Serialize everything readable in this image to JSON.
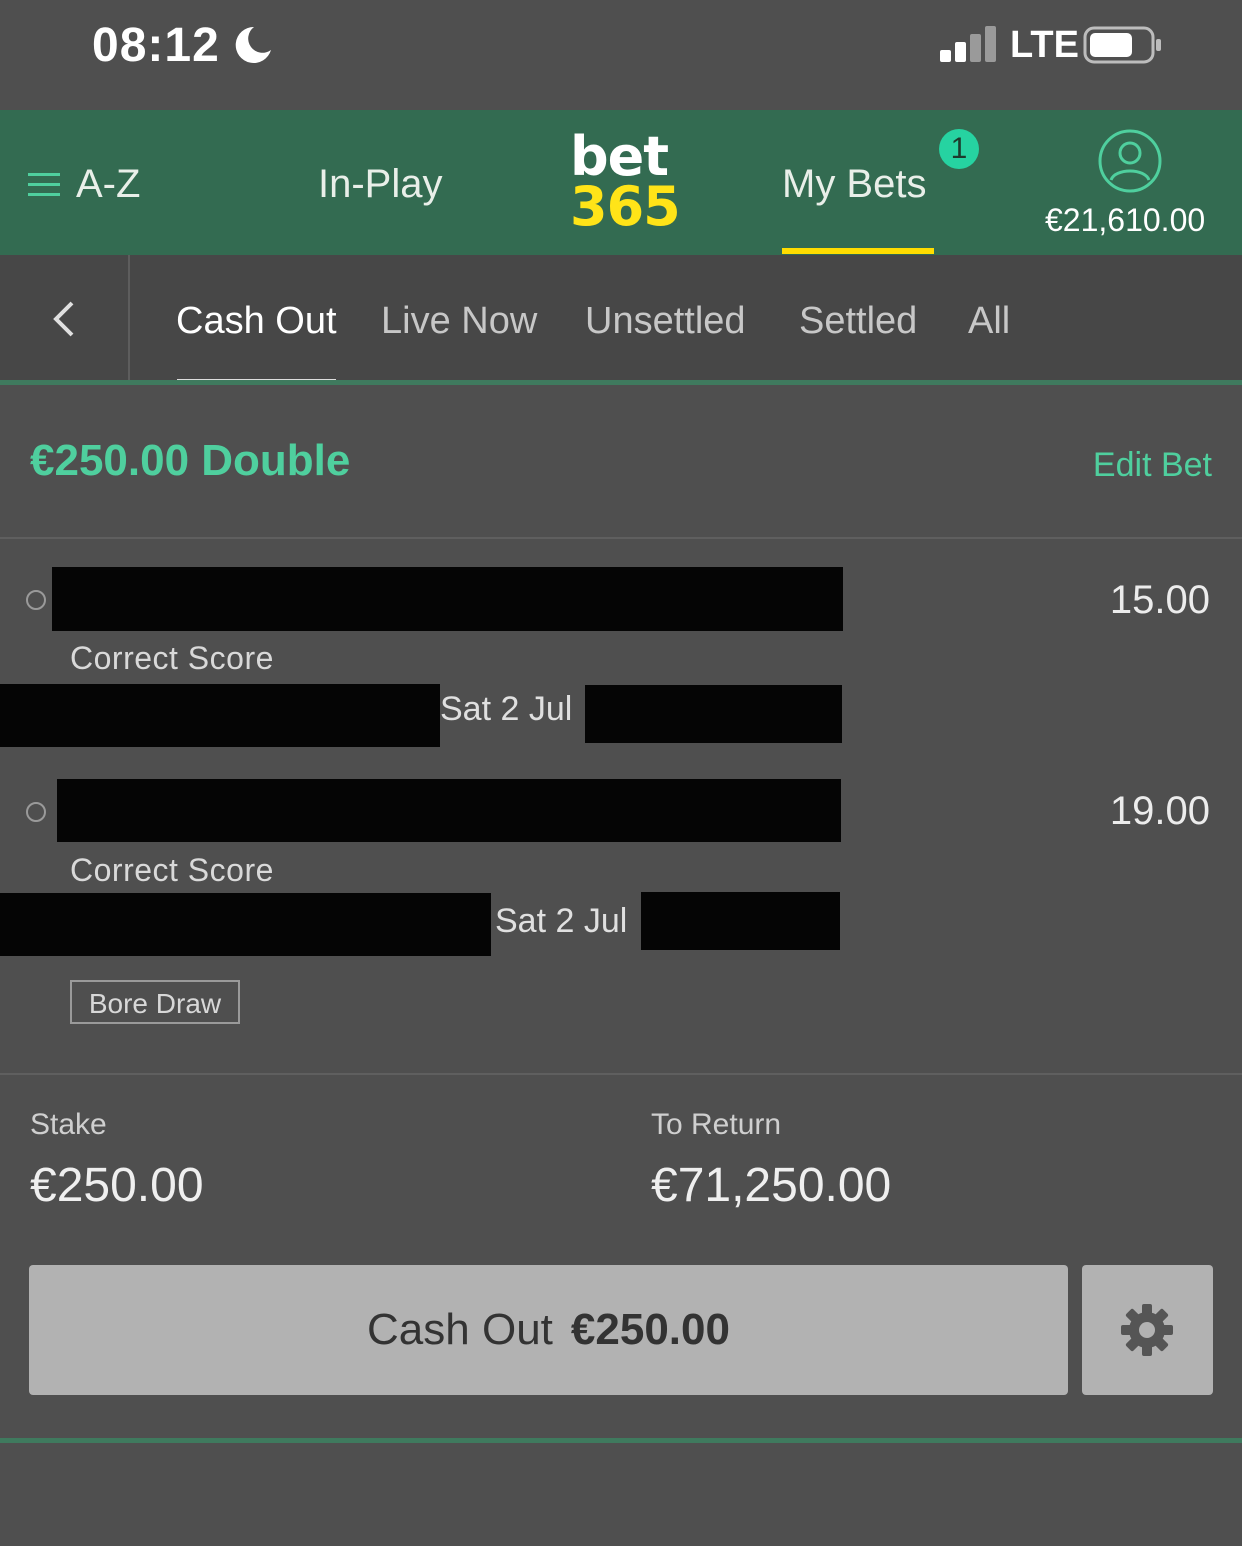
{
  "status_bar": {
    "time": "08:12",
    "network": "LTE"
  },
  "topnav": {
    "az_label": "A-Z",
    "inplay_label": "In-Play",
    "logo_line1": "bet",
    "logo_line2": "365",
    "mybets_label": "My Bets",
    "mybets_badge": "1",
    "balance": "€21,610.00"
  },
  "tabs": [
    {
      "label": "Cash Out"
    },
    {
      "label": "Live Now"
    },
    {
      "label": "Unsettled"
    },
    {
      "label": "Settled"
    },
    {
      "label": "All"
    }
  ],
  "bet": {
    "title": "€250.00 Double",
    "edit_label": "Edit Bet",
    "selections": [
      {
        "market": "Correct Score",
        "date": "Sat 2 Jul",
        "odds": "15.00"
      },
      {
        "market": "Correct Score",
        "date": "Sat 2 Jul",
        "odds": "19.00",
        "tag": "Bore Draw"
      }
    ],
    "stake_label": "Stake",
    "stake_value": "€250.00",
    "return_label": "To Return",
    "return_value": "€71,250.00",
    "cashout_label": "Cash Out",
    "cashout_amount": "€250.00"
  },
  "colors": {
    "header_green": "#336b51",
    "accent_green": "#4fcf9e",
    "underline_yellow": "#ffdd00",
    "logo_yellow": "#ffe418",
    "badge_teal": "#26d3a1"
  }
}
